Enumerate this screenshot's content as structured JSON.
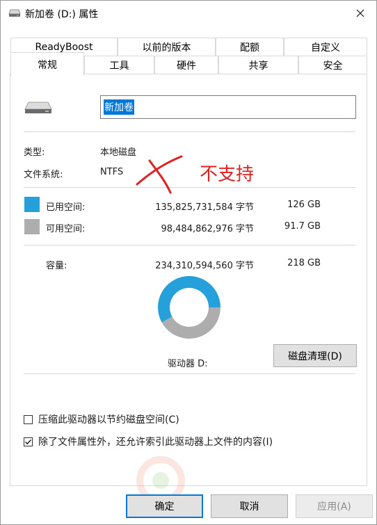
{
  "window": {
    "title": "新加卷 (D:) 属性"
  },
  "tabs": {
    "row1": [
      "ReadyBoost",
      "以前的版本",
      "配额",
      "自定义"
    ],
    "row2": [
      "常规",
      "工具",
      "硬件",
      "共享",
      "安全"
    ],
    "active": "常规"
  },
  "general": {
    "volume_name": "新加卷",
    "type_label": "类型:",
    "type_value": "本地磁盘",
    "fs_label": "文件系统:",
    "fs_value": "NTFS",
    "used_label": "已用空间:",
    "used_bytes": "135,825,731,584 字节",
    "used_size": "126 GB",
    "free_label": "可用空间:",
    "free_bytes": "98,484,862,976 字节",
    "free_size": "91.7 GB",
    "capacity_label": "容量:",
    "capacity_bytes": "234,310,594,560 字节",
    "capacity_size": "218 GB",
    "drive_label": "驱动器 D:",
    "cleanup_button": "磁盘清理(D)",
    "compress_label": "压缩此驱动器以节约磁盘空间(C)",
    "compress_checked": false,
    "index_label": "除了文件属性外，还允许索引此驱动器上文件的内容(I)",
    "index_checked": true,
    "used_fraction": 0.58,
    "used_color": "#26a0da",
    "free_color": "#adadad"
  },
  "annotation": {
    "text": "不支持",
    "color": "#e02020"
  },
  "buttons": {
    "ok": "确定",
    "cancel": "取消",
    "apply": "应用(A)"
  }
}
